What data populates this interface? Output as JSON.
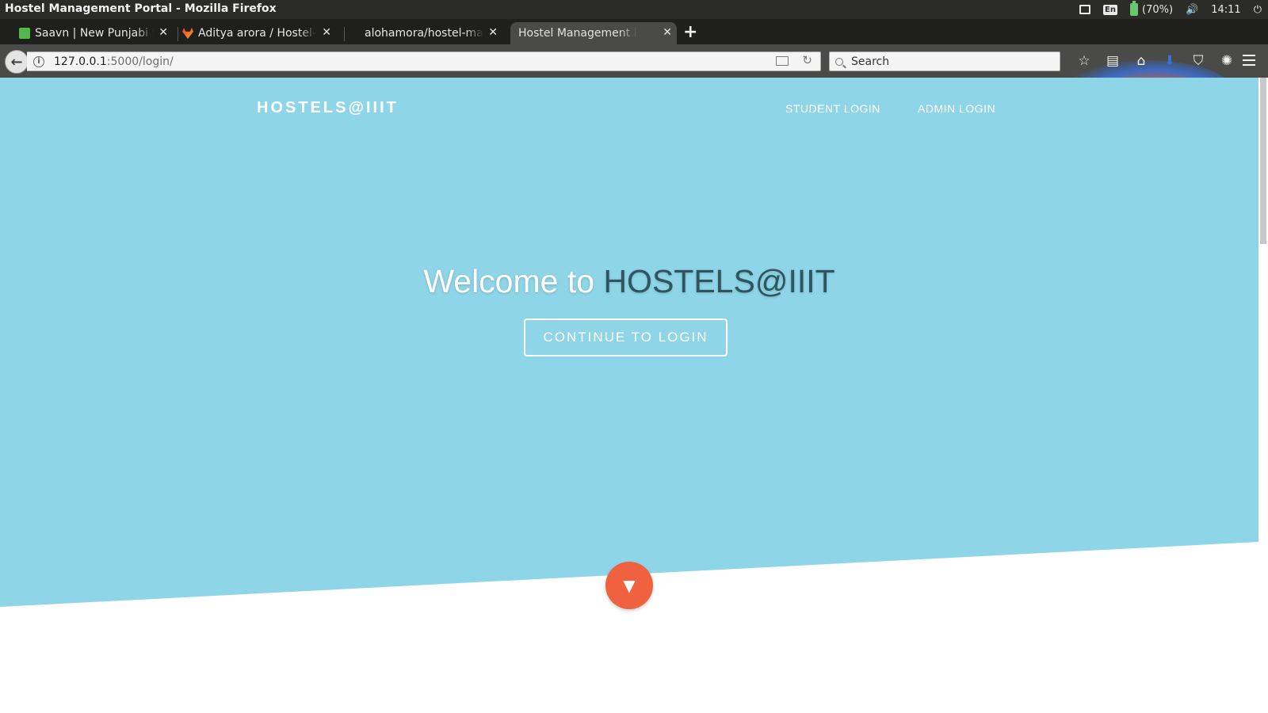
{
  "os": {
    "window_title": "Hostel Management Portal - Mozilla Firefox",
    "battery": "(70%)",
    "time": "14:11",
    "keyboard_layout": "En",
    "battery_color": "#69c86f"
  },
  "browser": {
    "tabs": [
      {
        "label": "Saavn | New Punjabi Songs",
        "icon": "saavn-icon",
        "active": false
      },
      {
        "label": "Aditya arora / Hostel-Management",
        "icon": "gitlab-icon",
        "active": false
      },
      {
        "label": "alohamora/hostel-management",
        "icon": "github-icon",
        "active": false
      },
      {
        "label": "Hostel Management Portal",
        "icon": "none",
        "active": true
      }
    ],
    "url_host": "127.0.0.1",
    "url_rest": ":5000/login/",
    "search_placeholder": "Search"
  },
  "page": {
    "brand": "HOSTELS@IIIT",
    "nav": {
      "student_login": "STUDENT LOGIN",
      "admin_login": "ADMIN LOGIN"
    },
    "welcome_prefix": "Welcome to",
    "welcome_highlight": "HOSTELS@IIIT",
    "cta_label": "CONTINUE TO LOGIN",
    "scroll_down_glyph": "▼",
    "colors": {
      "hero_bg": "#8fd5e8",
      "accent": "#f0623f",
      "headline_highlight": "#2e5560"
    }
  }
}
